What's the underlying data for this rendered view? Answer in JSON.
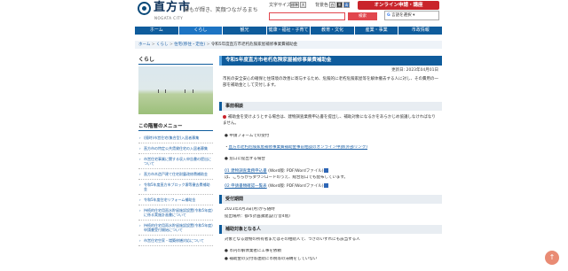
{
  "header": {
    "logo_name": "直方市",
    "logo_sub": "NOGATA CITY",
    "tagline": "誰もが輝き、笑顔つながるまち",
    "text_size_label": "文字サイズ",
    "text_size_normal": "標準",
    "text_size_large": "大",
    "color_label": "背景色",
    "color_white": "白",
    "color_black": "黒",
    "color_blue": "青",
    "apply_button": "オンライン申請・講座",
    "search_placeholder": "",
    "search_button": "検索",
    "translate_label": "言語を選択"
  },
  "nav": {
    "items": [
      "ホーム",
      "くらし",
      "観光",
      "健康・福祉・子育て",
      "教育・文化",
      "産業・事業",
      "市政情報"
    ]
  },
  "breadcrumb": {
    "home": "ホーム",
    "sep": " > ",
    "l1": "くらし",
    "l2": "住宅(移住・定住)",
    "current": "令和5年度直方市老朽危険家屋補修事業費補助金"
  },
  "sidebar": {
    "title": "くらし",
    "menu_title": "この階層のメニュー",
    "items": [
      "(随時)市営住宅(集合型)入居者募集",
      "直方市の特定公共賃貸住宅の入居者募集",
      "市営住宅事業に関する収入申告書の提出について",
      "直方市木造戸建て住宅耐震改修費補助金",
      "令和5年度直方市ブロック塀等撤去費補助金",
      "令和5年度住宅リフォーム補助金",
      "持続的住宅用雨水貯留施設設置(令和5年度)に係る実施計画書について",
      "持続的住宅用雨水貯留施設設置(令和5年度)申請書受付開始について",
      "市営住宅空家・増築修繕対応について"
    ]
  },
  "main": {
    "title": "令和5年度直方市老朽危険家屋補修事業費補助金",
    "updated": "更新日: 2023年04月01日",
    "intro": "市民の安全安心の確保と住環境の改善に寄与するため、危険的に老朽危険家屋等を解体撤去する人に対し、その費用の一部を補助金として交付します。",
    "section1_title": "事前相談",
    "section1_note": "補助金を受けようとする場合は、建物調査業務申込書を提出し、補助対象になるかをあらかじめ協議しなければなりません。",
    "bullet_form": "申請フォームでの受付",
    "form_link": "直方市老朽危険家屋補修事業費補助金事前相談のオンライン申請(外部リンク)",
    "bullet_window": "窓口に提出する場合",
    "file1": "01 建物調査業務申込書",
    "file1_meta": "(Word版: PDF/Wordファイル)",
    "file_note": "は、こちらからダウンロードのうえ、総合窓口でも配布しています。",
    "file2": "02 申請書類確認一覧表",
    "file2_meta": "(Word版: PDF/Wordファイル)",
    "section2_title": "受付期間",
    "period": "2023年4月3日(月)から随時",
    "period_place": "提出場所：都市計画課建設(庁舎4階)",
    "section3_title": "補助対象となる人",
    "target_intro": "対象となる建物の所有者またはその相続人で、つぎのいずれにも該当する人",
    "target_1": "市内の解体業者に工事を依頼",
    "target_2": "補助金の交付等連続に市税等の滞納をしていない"
  },
  "ui": {
    "scroll_top_label": "↑"
  }
}
